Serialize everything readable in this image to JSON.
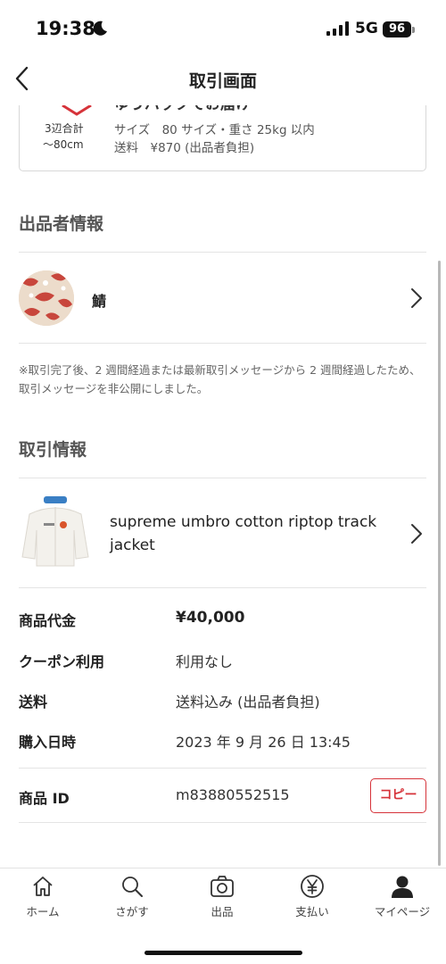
{
  "status_bar": {
    "time": "19:38",
    "network": "5G",
    "battery": "96"
  },
  "header": {
    "title": "取引画面",
    "back_icon": "chevron-left-icon"
  },
  "shipping": {
    "method_partial": "ゆうパックでお届け",
    "dimension_label": "3辺合計",
    "dimension_value": "〜80cm",
    "size_line": "サイズ　80 サイズ・重さ 25kg 以内",
    "fee_line": "送料　¥870 (出品者負担)"
  },
  "seller_section": {
    "heading": "出品者情報",
    "name": "鯖"
  },
  "notice": "※取引完了後、2 週間経過または最新取引メッセージから 2 週間経過したため、取引メッセージを非公開にしました。",
  "transaction_section": {
    "heading": "取引情報",
    "product_title": "supreme umbro cotton riptop track jacket"
  },
  "details": [
    {
      "label": "商品代金",
      "value": "¥40,000"
    },
    {
      "label": "クーポン利用",
      "value": "利用なし"
    },
    {
      "label": "送料",
      "value": "送料込み (出品者負担)"
    },
    {
      "label": "購入日時",
      "value": "2023 年 9 月 26 日 13:45"
    }
  ],
  "product_id": {
    "label": "商品 ID",
    "value": "m83880552515",
    "copy_label": "コピー"
  },
  "tabs": [
    {
      "label": "ホーム",
      "icon": "home-icon"
    },
    {
      "label": "さがす",
      "icon": "search-icon"
    },
    {
      "label": "出品",
      "icon": "camera-icon"
    },
    {
      "label": "支払い",
      "icon": "yen-icon"
    },
    {
      "label": "マイページ",
      "icon": "person-icon"
    }
  ],
  "colors": {
    "accent": "#d6333a",
    "text": "#222222",
    "muted": "#666666",
    "divider": "#e4e4e4"
  }
}
